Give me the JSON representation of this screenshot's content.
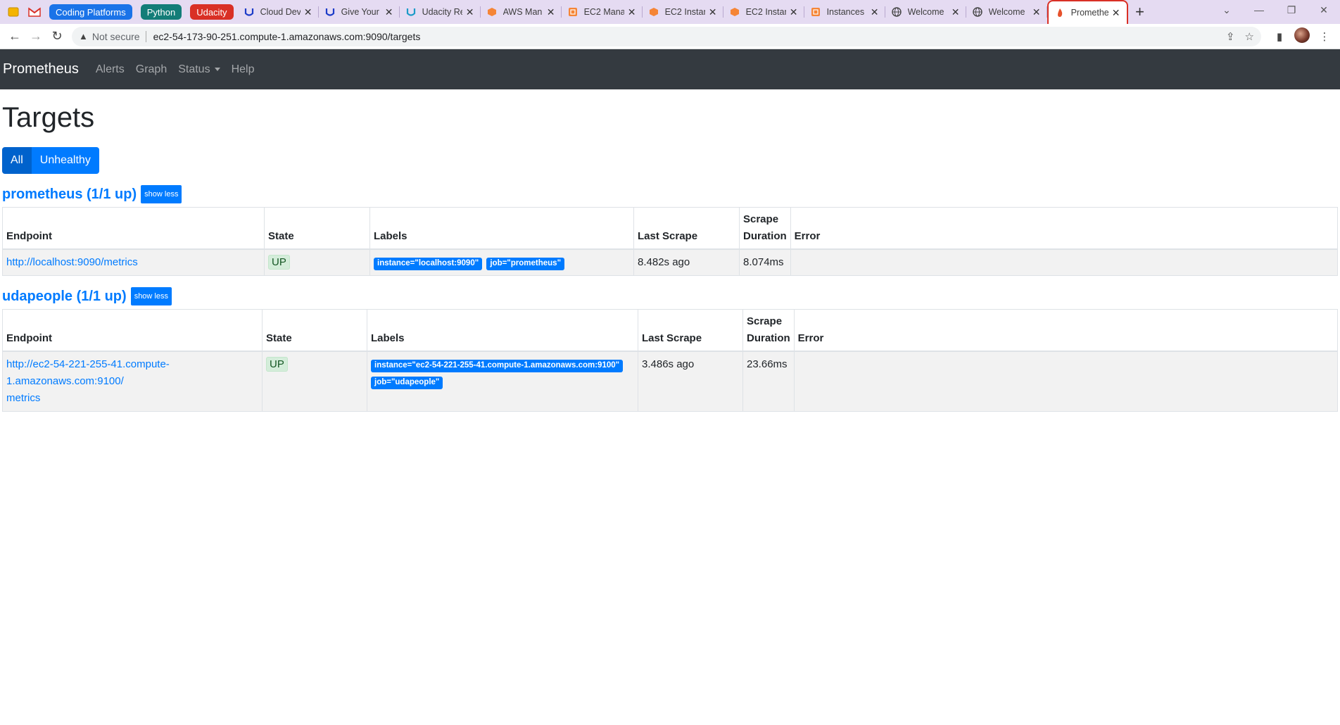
{
  "browser": {
    "group_chips": [
      {
        "label": "Coding Platforms",
        "color": "#1a73e8"
      },
      {
        "label": "Python",
        "color": "#137d78"
      },
      {
        "label": "Udacity",
        "color": "#d93025"
      }
    ],
    "tabs": [
      {
        "title": "Cloud Dev",
        "icon": "udacity-icon"
      },
      {
        "title": "Give Your",
        "icon": "udacity-icon"
      },
      {
        "title": "Udacity Re",
        "icon": "udacity-icon"
      },
      {
        "title": "AWS Man",
        "icon": "aws-icon"
      },
      {
        "title": "EC2 Mana",
        "icon": "aws-ec2-icon"
      },
      {
        "title": "EC2 Instan",
        "icon": "aws-icon"
      },
      {
        "title": "EC2 Instan",
        "icon": "aws-icon"
      },
      {
        "title": "Instances",
        "icon": "aws-ec2-icon"
      },
      {
        "title": "Welcome",
        "icon": "globe-icon"
      },
      {
        "title": "Welcome",
        "icon": "globe-icon"
      }
    ],
    "active_tab": {
      "title": "Promethe",
      "icon": "prometheus-flame-icon"
    },
    "address": {
      "not_secure": "Not secure",
      "url": "ec2-54-173-90-251.compute-1.amazonaws.com:9090/targets"
    }
  },
  "navbar": {
    "brand": "Prometheus",
    "links": [
      "Alerts",
      "Graph",
      "Status",
      "Help"
    ]
  },
  "page": {
    "title": "Targets",
    "filters": [
      "All",
      "Unhealthy"
    ]
  },
  "columns": {
    "endpoint": "Endpoint",
    "state": "State",
    "labels": "Labels",
    "last_scrape": "Last Scrape",
    "scrape_duration_1": "Scrape",
    "scrape_duration_2": "Duration",
    "error": "Error"
  },
  "pools": [
    {
      "title": "prometheus (1/1 up)",
      "toggle": "show less",
      "targets": [
        {
          "endpoint_1": "http://localhost:9090/metrics",
          "endpoint_2": "",
          "state": "UP",
          "labels": [
            "instance=\"localhost:9090\"",
            "job=\"prometheus\""
          ],
          "last_scrape": "8.482s ago",
          "duration": "8.074ms",
          "error": ""
        }
      ]
    },
    {
      "title": "udapeople (1/1 up)",
      "toggle": "show less",
      "targets": [
        {
          "endpoint_1": "http://ec2-54-221-255-41.compute-1.amazonaws.com:9100/",
          "endpoint_2": "metrics",
          "state": "UP",
          "labels": [
            "instance=\"ec2-54-221-255-41.compute-1.amazonaws.com:9100\"",
            "job=\"udapeople\""
          ],
          "last_scrape": "3.486s ago",
          "duration": "23.66ms",
          "error": ""
        }
      ]
    }
  ]
}
